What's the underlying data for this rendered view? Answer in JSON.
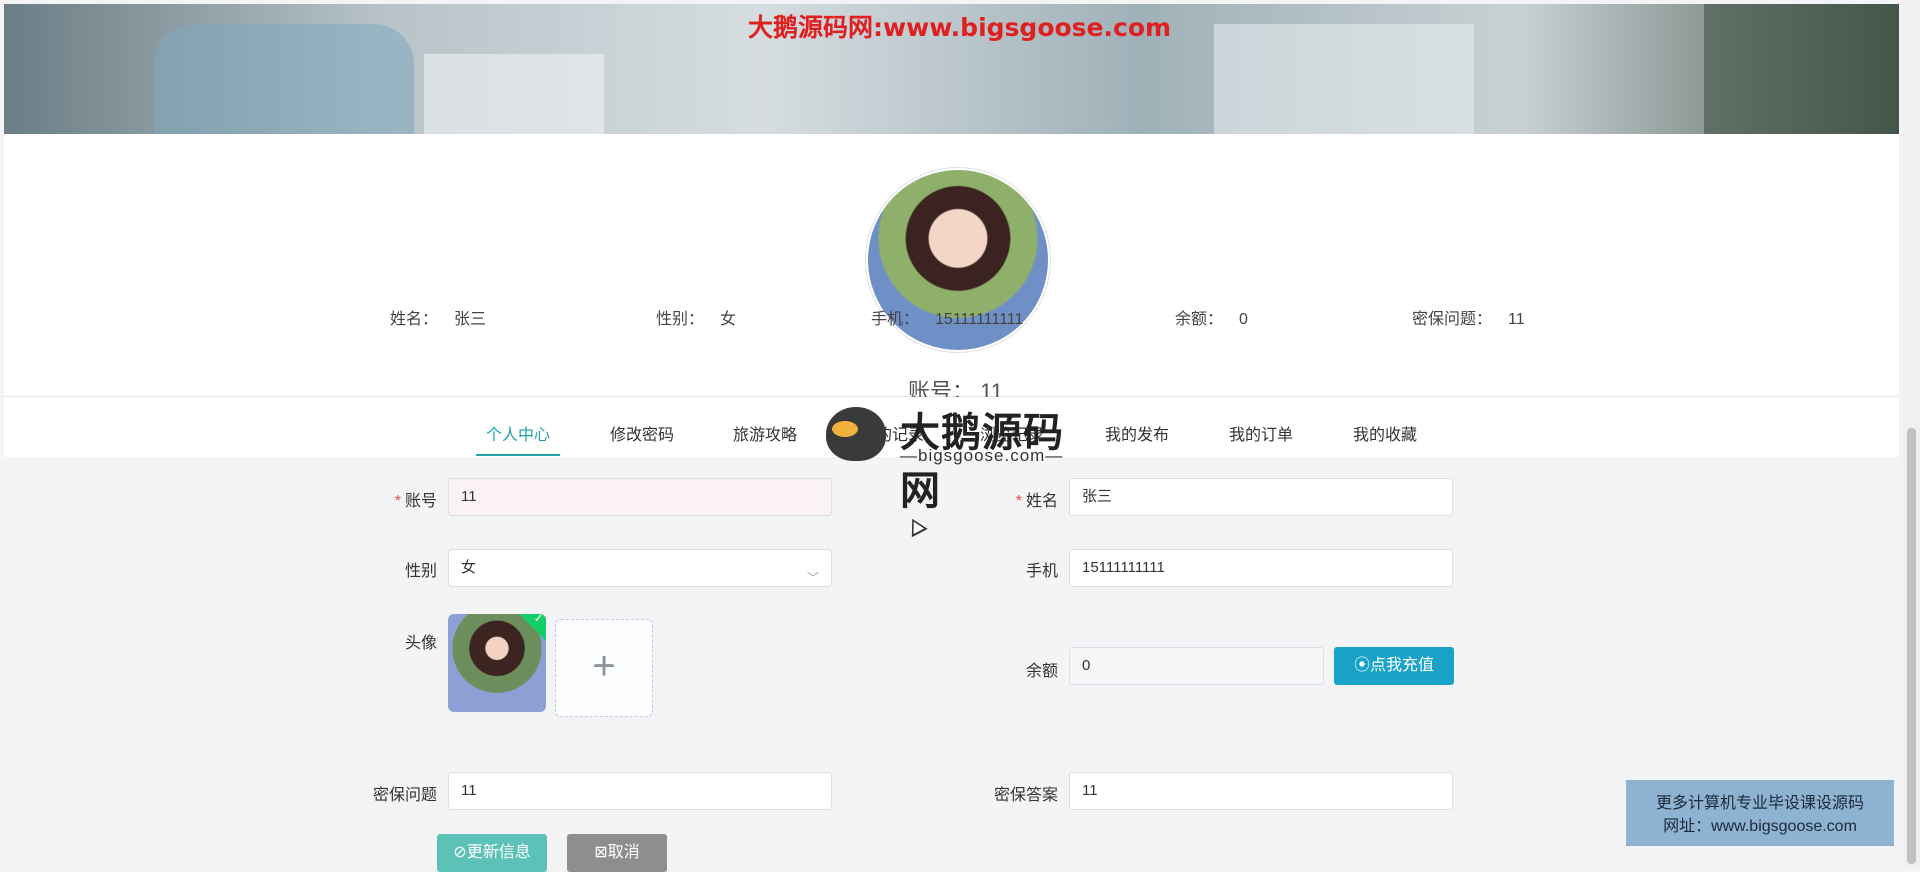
{
  "watermark_top": "大鹅源码网:www.bigsgoose.com",
  "profile": {
    "account_label": "账号：",
    "account_value": "11",
    "info": [
      {
        "label": "姓名：",
        "value": "张三"
      },
      {
        "label": "性别：",
        "value": "女"
      },
      {
        "label": "手机：",
        "value": "15111111111"
      },
      {
        "label": "余额：",
        "value": "0"
      },
      {
        "label": "密保问题：",
        "value": "11"
      }
    ]
  },
  "tabs": [
    {
      "label": "个人中心",
      "active": true
    },
    {
      "label": "修改密码"
    },
    {
      "label": "旅游攻略"
    },
    {
      "label": "我的记录"
    },
    {
      "label": "浏览记录"
    },
    {
      "label": "我的发布"
    },
    {
      "label": "我的订单"
    },
    {
      "label": "我的收藏"
    }
  ],
  "logo_watermark": {
    "cn": "大鹅源码网",
    "en": "—bigsgoose.com—"
  },
  "form": {
    "account": {
      "label": "账号",
      "value": "11",
      "required": true
    },
    "name": {
      "label": "姓名",
      "value": "张三",
      "required": true
    },
    "gender": {
      "label": "性别",
      "value": "女"
    },
    "phone": {
      "label": "手机",
      "value": "15111111111"
    },
    "avatar": {
      "label": "头像"
    },
    "balance": {
      "label": "余额",
      "value": "0"
    },
    "recharge_button": "⦿点我充值",
    "question": {
      "label": "密保问题",
      "value": "11"
    },
    "answer": {
      "label": "密保答案",
      "value": "11"
    },
    "update_button": "⊘更新信息",
    "cancel_button": "⊠取消"
  },
  "promo": {
    "line1": "更多计算机专业毕设课设源码",
    "line2": "网址：www.bigsgoose.com"
  },
  "icons": {
    "chevron": "chevron-down-icon",
    "plus": "plus-icon",
    "check": "check-icon"
  }
}
